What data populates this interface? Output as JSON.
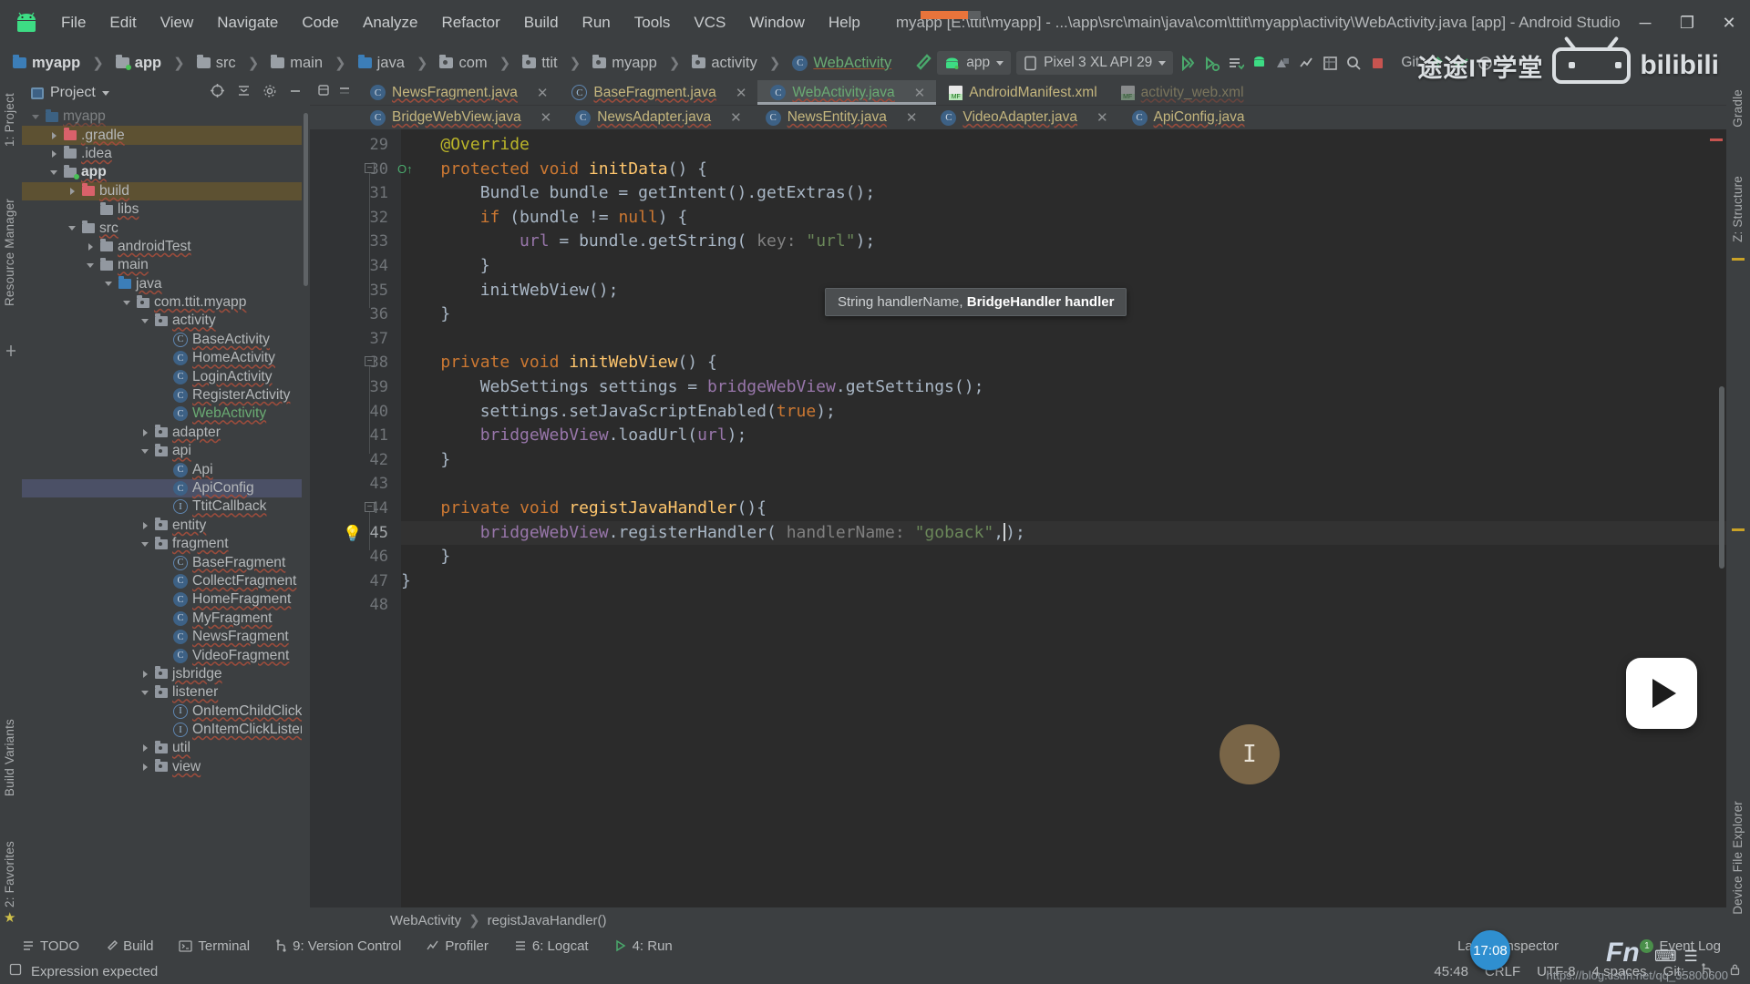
{
  "window": {
    "title": "myapp [E:\\ttit\\myapp] - ...\\app\\src\\main\\java\\com\\ttit\\myapp\\activity\\WebActivity.java [app] - Android Studio",
    "controls": {
      "minimize": "─",
      "maximize": "❐",
      "close": "✕"
    }
  },
  "menu": [
    {
      "label": "File"
    },
    {
      "label": "Edit"
    },
    {
      "label": "View"
    },
    {
      "label": "Navigate"
    },
    {
      "label": "Code"
    },
    {
      "label": "Analyze"
    },
    {
      "label": "Refactor"
    },
    {
      "label": "Build"
    },
    {
      "label": "Run"
    },
    {
      "label": "Tools"
    },
    {
      "label": "VCS"
    },
    {
      "label": "Window"
    },
    {
      "label": "Help"
    }
  ],
  "breadcrumb": [
    {
      "label": "myapp",
      "icon": "folder-icon",
      "style": "bold-blue"
    },
    {
      "label": "app",
      "icon": "module-icon",
      "style": "bold-green-dot"
    },
    {
      "label": "src",
      "icon": "folder-icon",
      "style": "plain"
    },
    {
      "label": "main",
      "icon": "folder-icon",
      "style": "plain"
    },
    {
      "label": "java",
      "icon": "source-folder-icon",
      "style": "blue"
    },
    {
      "label": "com",
      "icon": "package-icon",
      "style": "plain"
    },
    {
      "label": "ttit",
      "icon": "package-icon",
      "style": "plain"
    },
    {
      "label": "myapp",
      "icon": "package-icon",
      "style": "plain"
    },
    {
      "label": "activity",
      "icon": "package-icon",
      "style": "plain"
    },
    {
      "label": "WebActivity",
      "icon": "java-class-icon",
      "style": "green"
    }
  ],
  "toolbar": {
    "module_selector": "app",
    "device_selector": "Pixel 3 XL API 29",
    "git_label": "Git:"
  },
  "project_panel": {
    "title": "Project",
    "tree": [
      {
        "label": "myapp",
        "indent": 0,
        "icon": "project-icon",
        "arrow": "down",
        "sel": "none",
        "clipped": true
      },
      {
        "label": ".gradle",
        "indent": 1,
        "icon": "folder-red",
        "arrow": "right",
        "sel": "amber"
      },
      {
        "label": ".idea",
        "indent": 1,
        "icon": "folder",
        "arrow": "right",
        "sel": "none"
      },
      {
        "label": "app",
        "indent": 1,
        "icon": "folder-green-dot",
        "arrow": "down",
        "sel": "none",
        "bold": true
      },
      {
        "label": "build",
        "indent": 2,
        "icon": "folder-red",
        "arrow": "right",
        "sel": "amber"
      },
      {
        "label": "libs",
        "indent": 3,
        "icon": "folder",
        "arrow": "none",
        "sel": "none"
      },
      {
        "label": "src",
        "indent": 2,
        "icon": "folder",
        "arrow": "down",
        "sel": "none"
      },
      {
        "label": "androidTest",
        "indent": 3,
        "icon": "folder",
        "arrow": "right",
        "sel": "none"
      },
      {
        "label": "main",
        "indent": 3,
        "icon": "folder",
        "arrow": "down",
        "sel": "none"
      },
      {
        "label": "java",
        "indent": 4,
        "icon": "folder-blue",
        "arrow": "down",
        "sel": "none"
      },
      {
        "label": "com.ttit.myapp",
        "indent": 5,
        "icon": "package",
        "arrow": "down",
        "sel": "none"
      },
      {
        "label": "activity",
        "indent": 6,
        "icon": "package",
        "arrow": "down",
        "sel": "none"
      },
      {
        "label": "BaseActivity",
        "indent": 7,
        "icon": "class-abstract",
        "arrow": "none",
        "sel": "none"
      },
      {
        "label": "HomeActivity",
        "indent": 7,
        "icon": "class",
        "arrow": "none",
        "sel": "none"
      },
      {
        "label": "LoginActivity",
        "indent": 7,
        "icon": "class",
        "arrow": "none",
        "sel": "none"
      },
      {
        "label": "RegisterActivity",
        "indent": 7,
        "icon": "class",
        "arrow": "none",
        "sel": "none"
      },
      {
        "label": "WebActivity",
        "indent": 7,
        "icon": "class",
        "arrow": "none",
        "sel": "none",
        "green": true
      },
      {
        "label": "adapter",
        "indent": 6,
        "icon": "package",
        "arrow": "right",
        "sel": "none"
      },
      {
        "label": "api",
        "indent": 6,
        "icon": "package",
        "arrow": "down",
        "sel": "none"
      },
      {
        "label": "Api",
        "indent": 7,
        "icon": "class",
        "arrow": "none",
        "sel": "none"
      },
      {
        "label": "ApiConfig",
        "indent": 7,
        "icon": "class",
        "arrow": "none",
        "sel": "blue"
      },
      {
        "label": "TtitCallback",
        "indent": 7,
        "icon": "interface",
        "arrow": "none",
        "sel": "none"
      },
      {
        "label": "entity",
        "indent": 6,
        "icon": "package",
        "arrow": "right",
        "sel": "none"
      },
      {
        "label": "fragment",
        "indent": 6,
        "icon": "package",
        "arrow": "down",
        "sel": "none"
      },
      {
        "label": "BaseFragment",
        "indent": 7,
        "icon": "class-abstract",
        "arrow": "none",
        "sel": "none"
      },
      {
        "label": "CollectFragment",
        "indent": 7,
        "icon": "class",
        "arrow": "none",
        "sel": "none"
      },
      {
        "label": "HomeFragment",
        "indent": 7,
        "icon": "class",
        "arrow": "none",
        "sel": "none"
      },
      {
        "label": "MyFragment",
        "indent": 7,
        "icon": "class",
        "arrow": "none",
        "sel": "none"
      },
      {
        "label": "NewsFragment",
        "indent": 7,
        "icon": "class",
        "arrow": "none",
        "sel": "none"
      },
      {
        "label": "VideoFragment",
        "indent": 7,
        "icon": "class",
        "arrow": "none",
        "sel": "none"
      },
      {
        "label": "jsbridge",
        "indent": 6,
        "icon": "package",
        "arrow": "right",
        "sel": "none"
      },
      {
        "label": "listener",
        "indent": 6,
        "icon": "package",
        "arrow": "down",
        "sel": "none"
      },
      {
        "label": "OnItemChildClickListene",
        "indent": 7,
        "icon": "interface",
        "arrow": "none",
        "sel": "none"
      },
      {
        "label": "OnItemClickListener",
        "indent": 7,
        "icon": "interface",
        "arrow": "none",
        "sel": "none"
      },
      {
        "label": "util",
        "indent": 6,
        "icon": "package",
        "arrow": "right",
        "sel": "none"
      },
      {
        "label": "view",
        "indent": 6,
        "icon": "package",
        "arrow": "right",
        "sel": "none"
      }
    ]
  },
  "left_strip": [
    {
      "label": "1: Project"
    },
    {
      "label": "Resource Manager"
    },
    {
      "label": "Build Variants"
    },
    {
      "label": "2: Favorites"
    }
  ],
  "right_strip": [
    {
      "label": "Gradle"
    },
    {
      "label": "Z: Structure"
    },
    {
      "label": "Device File Explorer"
    }
  ],
  "editor_tabs_row1": [
    {
      "label": "NewsFragment.java",
      "icon": "java-class-icon",
      "active": false,
      "closable": true
    },
    {
      "label": "BaseFragment.java",
      "icon": "java-abstract-class-icon",
      "active": false,
      "closable": true
    },
    {
      "label": "WebActivity.java",
      "icon": "java-class-icon",
      "active": true,
      "closable": true
    },
    {
      "label": "AndroidManifest.xml",
      "icon": "manifest-icon",
      "active": false,
      "closable": false
    },
    {
      "label": "activity_web.xml",
      "icon": "layout-icon",
      "active": false,
      "closable": false
    }
  ],
  "editor_tabs_row2": [
    {
      "label": "BridgeWebView.java",
      "icon": "java-class-icon",
      "active": false,
      "closable": true
    },
    {
      "label": "NewsAdapter.java",
      "icon": "java-class-icon",
      "active": false,
      "closable": true
    },
    {
      "label": "NewsEntity.java",
      "icon": "java-class-icon",
      "active": false,
      "closable": true
    },
    {
      "label": "VideoAdapter.java",
      "icon": "java-class-icon",
      "active": false,
      "closable": true
    },
    {
      "label": "ApiConfig.java",
      "icon": "java-class-icon",
      "active": false,
      "closable": false
    }
  ],
  "code": {
    "first_line_number": 29,
    "lines": [
      {
        "n": 29,
        "indent": 4,
        "tokens": [
          {
            "t": "@Override",
            "c": "an"
          }
        ]
      },
      {
        "n": 30,
        "indent": 4,
        "tokens": [
          {
            "t": "protected ",
            "c": "k"
          },
          {
            "t": "void ",
            "c": "k"
          },
          {
            "t": "initData",
            "c": "m"
          },
          {
            "t": "() {",
            "c": "ty"
          }
        ]
      },
      {
        "n": 31,
        "indent": 8,
        "tokens": [
          {
            "t": "Bundle bundle = ",
            "c": "ty"
          },
          {
            "t": "getIntent",
            "c": "cal"
          },
          {
            "t": "().",
            "c": "ty"
          },
          {
            "t": "getExtras",
            "c": "cal"
          },
          {
            "t": "();",
            "c": "ty"
          }
        ]
      },
      {
        "n": 32,
        "indent": 8,
        "tokens": [
          {
            "t": "if ",
            "c": "k"
          },
          {
            "t": "(bundle != ",
            "c": "ty"
          },
          {
            "t": "null",
            "c": "k"
          },
          {
            "t": ") {",
            "c": "ty"
          }
        ]
      },
      {
        "n": 33,
        "indent": 12,
        "tokens": [
          {
            "t": "url ",
            "c": "f"
          },
          {
            "t": "= bundle.",
            "c": "ty"
          },
          {
            "t": "getString",
            "c": "cal"
          },
          {
            "t": "( ",
            "c": "ty"
          },
          {
            "t": "key: ",
            "c": "hint"
          },
          {
            "t": "\"url\"",
            "c": "s"
          },
          {
            "t": ");",
            "c": "ty"
          }
        ]
      },
      {
        "n": 34,
        "indent": 8,
        "tokens": [
          {
            "t": "}",
            "c": "ty"
          }
        ]
      },
      {
        "n": 35,
        "indent": 8,
        "tokens": [
          {
            "t": "initWebView",
            "c": "cal"
          },
          {
            "t": "();",
            "c": "ty"
          }
        ]
      },
      {
        "n": 36,
        "indent": 4,
        "tokens": [
          {
            "t": "}",
            "c": "ty"
          }
        ]
      },
      {
        "n": 37,
        "indent": 0,
        "tokens": []
      },
      {
        "n": 38,
        "indent": 4,
        "tokens": [
          {
            "t": "private ",
            "c": "k"
          },
          {
            "t": "void ",
            "c": "k"
          },
          {
            "t": "initWebView",
            "c": "m"
          },
          {
            "t": "() {",
            "c": "ty"
          }
        ]
      },
      {
        "n": 39,
        "indent": 8,
        "tokens": [
          {
            "t": "WebSettings settings = ",
            "c": "ty"
          },
          {
            "t": "bridgeWebView",
            "c": "f"
          },
          {
            "t": ".",
            "c": "ty"
          },
          {
            "t": "getSettings",
            "c": "cal"
          },
          {
            "t": "();",
            "c": "ty"
          }
        ]
      },
      {
        "n": 40,
        "indent": 8,
        "tokens": [
          {
            "t": "settings.",
            "c": "ty"
          },
          {
            "t": "setJavaScriptEnabled",
            "c": "cal"
          },
          {
            "t": "(",
            "c": "ty"
          },
          {
            "t": "true",
            "c": "k"
          },
          {
            "t": ");",
            "c": "ty"
          }
        ]
      },
      {
        "n": 41,
        "indent": 8,
        "tokens": [
          {
            "t": "bridgeWebView",
            "c": "f"
          },
          {
            "t": ".",
            "c": "ty"
          },
          {
            "t": "loadUrl",
            "c": "cal"
          },
          {
            "t": "(",
            "c": "ty"
          },
          {
            "t": "url",
            "c": "f"
          },
          {
            "t": ");",
            "c": "ty"
          }
        ]
      },
      {
        "n": 42,
        "indent": 4,
        "tokens": [
          {
            "t": "}",
            "c": "ty"
          }
        ]
      },
      {
        "n": 43,
        "indent": 0,
        "tokens": []
      },
      {
        "n": 44,
        "indent": 4,
        "tokens": [
          {
            "t": "private ",
            "c": "k"
          },
          {
            "t": "void ",
            "c": "k"
          },
          {
            "t": "registJavaHandler",
            "c": "m"
          },
          {
            "t": "(){",
            "c": "ty"
          }
        ]
      },
      {
        "n": 45,
        "indent": 8,
        "tokens": [
          {
            "t": "bridgeWebView",
            "c": "f"
          },
          {
            "t": ".",
            "c": "ty"
          },
          {
            "t": "registerHandler",
            "c": "cal"
          },
          {
            "t": "( ",
            "c": "ty"
          },
          {
            "t": "handlerName: ",
            "c": "hint"
          },
          {
            "t": "\"goback\"",
            "c": "s"
          },
          {
            "t": ",",
            "c": "ty"
          },
          {
            "t": ");",
            "c": "ty"
          }
        ],
        "highlight": true,
        "bulb": true
      },
      {
        "n": 46,
        "indent": 4,
        "tokens": [
          {
            "t": "}",
            "c": "ty"
          }
        ]
      },
      {
        "n": 47,
        "indent": 0,
        "tokens": [
          {
            "t": "}",
            "c": "ty"
          }
        ]
      },
      {
        "n": 48,
        "indent": 0,
        "tokens": []
      }
    ],
    "parameter_tooltip": {
      "prefix": "String handlerName, ",
      "bold": "BridgeHandler handler"
    },
    "breadcrumb": [
      "WebActivity",
      "registJavaHandler()"
    ]
  },
  "tool_windows": [
    {
      "label": "TODO",
      "icon": "todo-icon"
    },
    {
      "label": "Build",
      "icon": "build-icon"
    },
    {
      "label": "Terminal",
      "icon": "terminal-icon"
    },
    {
      "label": "9: Version Control",
      "icon": "vcs-icon"
    },
    {
      "label": "Profiler",
      "icon": "profiler-icon"
    },
    {
      "label": "6: Logcat",
      "icon": "logcat-icon"
    },
    {
      "label": "4: Run",
      "icon": "run-icon"
    },
    {
      "label": "Layout Inspector",
      "icon": "layout-inspector-icon"
    },
    {
      "label": "Event Log",
      "icon": "event-log-icon",
      "badge": "1"
    }
  ],
  "status_bar": {
    "message": "Expression expected",
    "caret": "45:48",
    "line_separator": "CRLF",
    "encoding": "UTF-8",
    "indent": "4 spaces",
    "git_label": "Git:"
  },
  "overlays": {
    "bilibili_text": "bilibili",
    "channel_text": "途途IT学堂",
    "clock": "17:08",
    "fn_label": "Fn",
    "watermark_url": "https://blog.csdn.net/qq_35800600"
  },
  "colors": {
    "ide_chrome": "#3c3f41",
    "editor_bg": "#2b2b2b",
    "gutter_bg": "#313335",
    "accent_green": "#6aab73",
    "tab_text": "#c5b67e",
    "selection_amber": "#5d5132",
    "selection_blue": "#4b5066",
    "string_green": "#6a8759",
    "keyword_orange": "#cc7832",
    "field_purple": "#9876aa",
    "method_yellow": "#ffc66d",
    "error_red": "#9c4c3c"
  }
}
